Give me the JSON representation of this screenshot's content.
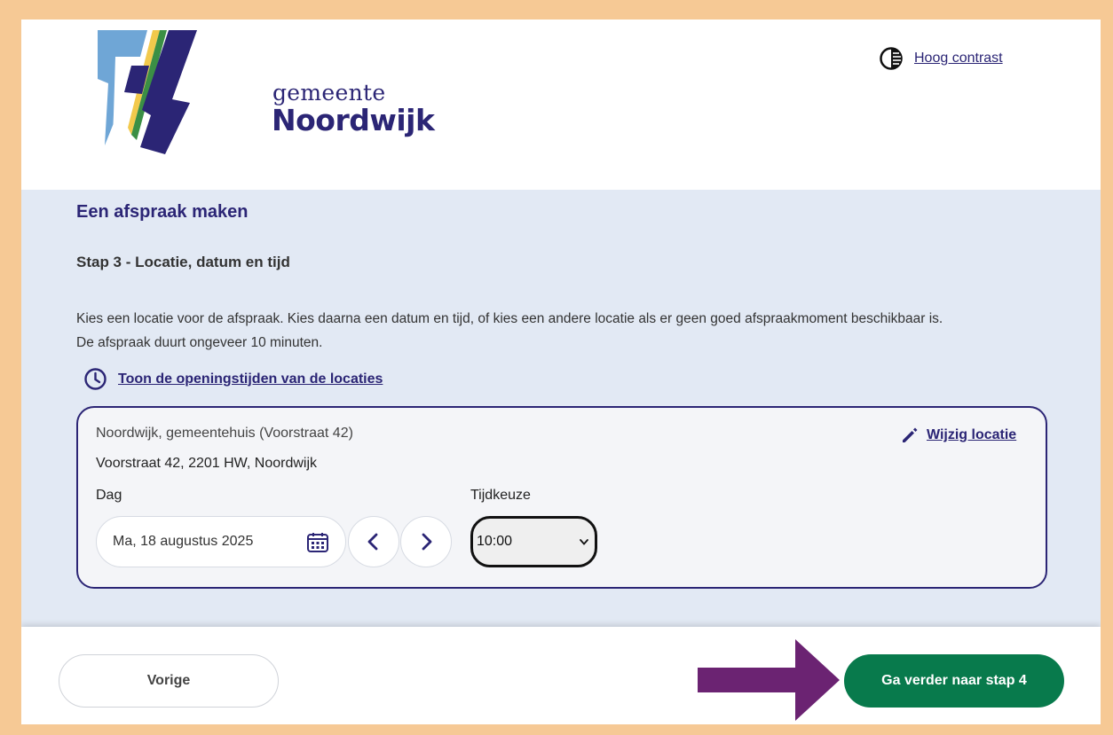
{
  "header": {
    "logo_line1": "gemeente",
    "logo_line2": "Noordwijk",
    "contrast_icon": "contrast-icon",
    "contrast_label": "Hoog contrast"
  },
  "main": {
    "title": "Een afspraak maken",
    "step_title": "Stap 3 - Locatie, datum en tijd",
    "intro_line1": "Kies een locatie voor de afspraak. Kies daarna een datum en tijd, of kies een andere locatie als er geen goed afspraakmoment beschikbaar is.",
    "intro_line2": "De afspraak duurt ongeveer 10 minuten.",
    "hours_icon": "clock-icon",
    "hours_link": "Toon de openingstijden van de locaties"
  },
  "location_card": {
    "name": "Noordwijk, gemeentehuis (Voorstraat 42)",
    "address": "Voorstraat 42, 2201 HW, Noordwijk",
    "edit_icon": "pencil-icon",
    "edit_label": "Wijzig locatie",
    "day_label": "Dag",
    "date_value": "Ma, 18 augustus 2025",
    "time_label": "Tijdkeuze",
    "time_value": "10:00"
  },
  "footer": {
    "prev_label": "Vorige",
    "next_label": "Ga verder naar stap 4"
  },
  "colors": {
    "brand": "#2b2575",
    "primary_button": "#087a4c",
    "frame": "#f6c995",
    "panel_background": "#e2e9f4",
    "annotation_arrow": "#6b2372"
  }
}
